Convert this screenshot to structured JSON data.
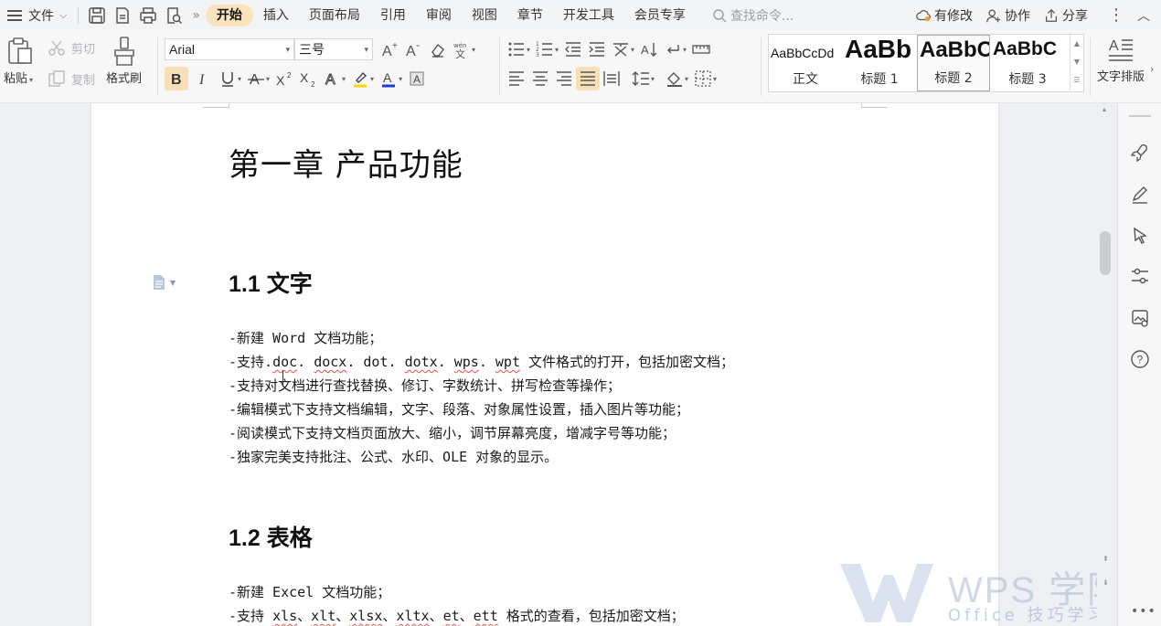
{
  "menubar": {
    "file_label": "文件",
    "tabs": [
      {
        "label": "开始",
        "active": true
      },
      {
        "label": "插入"
      },
      {
        "label": "页面布局"
      },
      {
        "label": "引用"
      },
      {
        "label": "审阅"
      },
      {
        "label": "视图"
      },
      {
        "label": "章节"
      },
      {
        "label": "开发工具"
      },
      {
        "label": "会员专享"
      }
    ],
    "search_placeholder": "查找命令...",
    "actions": {
      "changes": "有修改",
      "collab": "协作",
      "share": "分享"
    },
    "icons": [
      "save-icon",
      "export-pdf-icon",
      "print-icon",
      "print-preview-icon"
    ]
  },
  "ribbon": {
    "clipboard": {
      "paste": "粘贴",
      "cut": "剪切",
      "copy": "复制",
      "format_painter": "格式刷"
    },
    "font": {
      "name": "Arial",
      "size": "三号"
    },
    "styles": [
      {
        "sample": "AaBbCcDd",
        "name": "正文"
      },
      {
        "sample": "AaBb",
        "name": "标题 1"
      },
      {
        "sample": "AaBbC",
        "name": "标题 2",
        "selected": true
      },
      {
        "sample": "AaBbC",
        "name": "标题 3"
      }
    ],
    "text_layout": "文字排版",
    "accent": "#f9dfb7",
    "font_color": "#1f3bd1"
  },
  "document": {
    "chapter_title": "第一章 产品功能",
    "section1": {
      "heading": "1.1  文字",
      "lines": [
        [
          "-新建 Word 文档功能；"
        ],
        [
          "-支持.",
          "doc",
          ". ",
          "docx",
          ". dot. ",
          "dotx",
          ". ",
          "wps",
          ". ",
          "wpt",
          " 文件格式的打开，包括加密文档；"
        ],
        [
          "-支持对文档进行查找替换、修订、字数统计、拼写检查等操作；"
        ],
        [
          "-编辑模式下支持文档编辑，文字、段落、对象属性设置，插入图片等功能；"
        ],
        [
          "-阅读模式下支持文档页面放大、缩小，调节屏幕亮度，增减字号等功能；"
        ],
        [
          "-独家完美支持批注、公式、水印、OLE 对象的显示。"
        ]
      ]
    },
    "section2": {
      "heading": "1.2  表格",
      "lines": [
        [
          "-新建 Excel 文档功能；"
        ],
        [
          "-支持 ",
          "xls",
          "、",
          "xlt",
          "、",
          "xlsx",
          "、",
          "xltx",
          "、",
          "et",
          "、",
          "ett",
          " 格式的查看，包括加密文档；"
        ]
      ]
    }
  },
  "watermark": {
    "brand": "WPS 学院",
    "sub": "Office 技巧学习平台"
  },
  "sidepanel_icons": [
    "rocket-icon",
    "pen-icon",
    "pointer-icon",
    "sliders-icon",
    "ai-image-icon",
    "help-icon"
  ]
}
